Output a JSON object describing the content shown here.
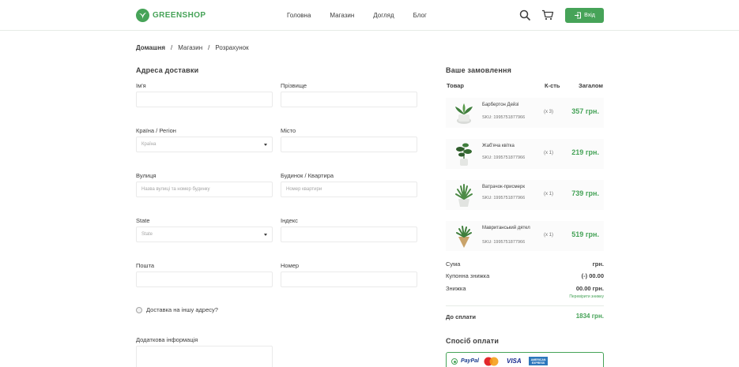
{
  "header": {
    "logo_text": "GREENSHOP",
    "nav": [
      "Головна",
      "Магазин",
      "Догляд",
      "Блог"
    ],
    "login_label": "Вхід"
  },
  "breadcrumb": [
    "Домашня",
    "Магазин",
    "Розрахунок"
  ],
  "billing": {
    "title": "Адреса доставки",
    "first_name_label": "Ім'я",
    "last_name_label": "Прізвище",
    "country_label": "Країна / Регіон",
    "country_placeholder": "Країна",
    "city_label": "Місто",
    "street_label": "Вулиця",
    "street_placeholder": "Назва вулиці та номер будинку",
    "house_label": "Будинок / Квартира",
    "house_placeholder": "Номер квартири",
    "state_label": "State",
    "state_placeholder": "State",
    "zip_label": "Індекс",
    "email_label": "Пошта",
    "phone_label": "Номер",
    "other_address_label": "Доставка на іншу адресу?",
    "notes_label": "Додаткова інформація"
  },
  "order": {
    "title": "Ваше замовлення",
    "col_product": "Товар",
    "col_qty": "К-сть",
    "col_total": "Загалом",
    "items": [
      {
        "name": "Барбертон Дейзі",
        "sku_label": "SKU:",
        "sku": "1995751877966",
        "qty": "(x 3)",
        "price": "357 грн."
      },
      {
        "name": "Жаб'яча квітка",
        "sku_label": "SKU:",
        "sku": "1995751877966",
        "qty": "(x 1)",
        "price": "219 грн."
      },
      {
        "name": "Ватрачок-присмерк",
        "sku_label": "SKU:",
        "sku": "1995751877966",
        "qty": "(x 1)",
        "price": "739 грн."
      },
      {
        "name": "Мавританський дятел",
        "sku_label": "SKU:",
        "sku": "1995751877966",
        "qty": "(x 1)",
        "price": "519 грн."
      }
    ],
    "subtotal_label": "Сума",
    "subtotal_value": "грн.",
    "coupon_label": "Купонна знижка",
    "coupon_value": "(-) 00.00",
    "discount_label": "Знижка",
    "discount_value": "00.00 грн.",
    "discount_link": "Перевірити знижку",
    "total_label": "До сплати",
    "total_value": "1834 грн.",
    "payment_title": "Спосіб оплати",
    "payment_logos": [
      "PayPal",
      "mastercard",
      "VISA",
      "AMERICAN EXPRESS"
    ]
  },
  "colors": {
    "accent": "#46a358",
    "text": "#3d3d3d"
  }
}
